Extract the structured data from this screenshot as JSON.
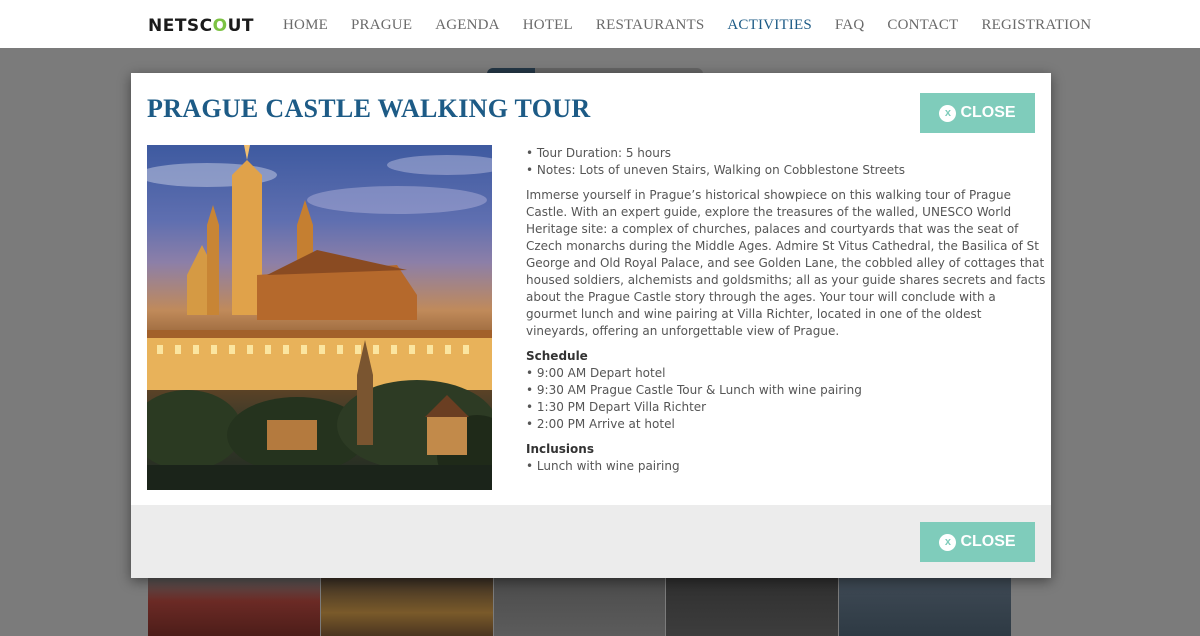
{
  "header": {
    "logo": {
      "before": "NETSC",
      "highlight": "O",
      "after": "UT"
    },
    "nav": [
      "HOME",
      "PRAGUE",
      "AGENDA",
      "HOTEL",
      "RESTAURANTS",
      "ACTIVITIES",
      "FAQ",
      "CONTACT",
      "REGISTRATION"
    ],
    "active": "ACTIVITIES",
    "accent_color": "#1d5b86"
  },
  "modal": {
    "title": "PRAGUE CASTLE WALKING TOUR",
    "close_label": "CLOSE",
    "close_icon": "close-icon",
    "button_color": "#7fccbb",
    "details": [
      "• Tour Duration: 5 hours",
      "• Notes: Lots of uneven Stairs, Walking on Cobblestone Streets"
    ],
    "description": "Immerse yourself in Prague’s historical showpiece on this walking tour of Prague Castle. With an expert guide, explore the treasures of the walled, UNESCO World Heritage site: a complex of churches, palaces and courtyards that was the seat of Czech monarchs during the Middle Ages. Admire St Vitus Cathedral, the Basilica of St George and Old Royal Palace, and see Golden Lane, the cobbled alley of cottages that housed soldiers, alchemists and goldsmiths; all as your guide shares secrets and facts about the Prague Castle story through the ages. Your tour will conclude with a gourmet lunch and wine pairing at Villa Richter, located in one of the oldest vineyards, offering an unforgettable view of Prague.",
    "schedule_heading": "Schedule",
    "schedule": [
      "• 9:00 AM Depart hotel",
      "• 9:30 AM Prague Castle Tour & Lunch with wine pairing",
      "• 1:30 PM Depart Villa Richter",
      "• 2:00 PM Arrive at hotel"
    ],
    "inclusions_heading": "Inclusions",
    "inclusions": [
      "• Lunch with wine pairing"
    ]
  }
}
